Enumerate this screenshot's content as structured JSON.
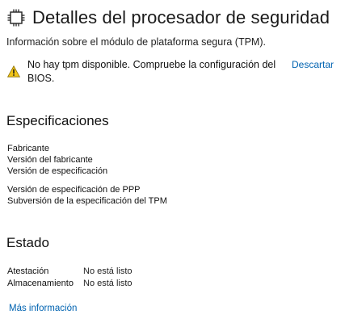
{
  "header": {
    "title": "Detalles del procesador de seguridad",
    "subtitle": "Información sobre el módulo de plataforma segura (TPM).",
    "icon": "chip-icon"
  },
  "warning": {
    "icon": "warning-icon",
    "message": "No hay tpm disponible. Compruebe la configuración del BIOS.",
    "dismiss_label": "Descartar",
    "accent_color": "#f0c419"
  },
  "specifications": {
    "heading": "Especificaciones",
    "fields": [
      "Fabricante",
      "Versión del fabricante",
      "Versión de especificación",
      "Versión de especificación de PPP",
      "Subversión de la especificación del TPM"
    ]
  },
  "status": {
    "heading": "Estado",
    "rows": [
      {
        "label": "Atestación",
        "value": "No está listo"
      },
      {
        "label": "Almacenamiento",
        "value": "No está listo"
      }
    ]
  },
  "footer": {
    "more_info_label": "Más información",
    "link_color": "#0063b1"
  }
}
